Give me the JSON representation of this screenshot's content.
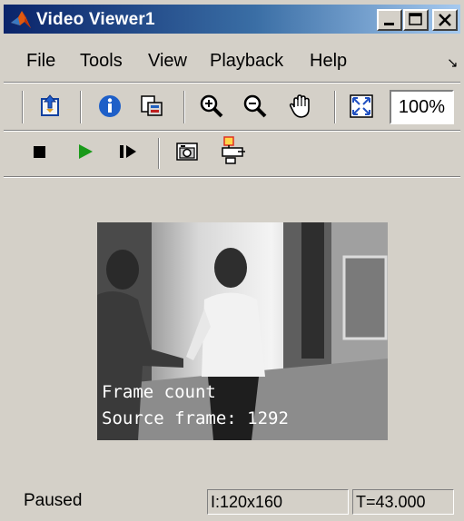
{
  "window": {
    "title": "Video Viewer1"
  },
  "title_buttons": {
    "minimize": "minimize-icon",
    "maximize": "maximize-icon",
    "close": "close-icon"
  },
  "menu": {
    "items": [
      "File",
      "Tools",
      "View",
      "Playback",
      "Help"
    ],
    "overflow_icon": "menu-arrow-icon"
  },
  "toolbar1": {
    "icons": [
      "open-model-icon",
      "info-icon",
      "print-icon",
      "zoom-in-icon",
      "zoom-out-icon",
      "pan-hand-icon",
      "fit-to-view-icon"
    ],
    "zoom_value": "100%"
  },
  "toolbar2": {
    "icons": [
      "stop-icon",
      "play-icon",
      "step-forward-icon",
      "snapshot-icon",
      "highlight-block-icon"
    ]
  },
  "video": {
    "overlay_line1": "Frame count",
    "overlay_line2": "Source frame: 1292"
  },
  "status": {
    "state": "Paused",
    "image_size": "I:120x160",
    "time": "T=43.000"
  },
  "colors": {
    "title_start": "#0a246a",
    "title_end": "#a6caf0",
    "chrome": "#d4d0c8",
    "play_green": "#1a9a1a"
  }
}
